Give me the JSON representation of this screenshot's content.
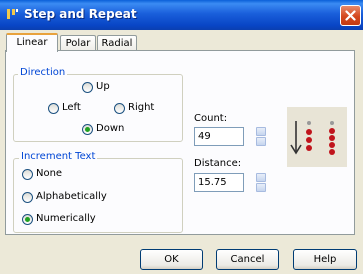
{
  "window": {
    "title": "Step and Repeat"
  },
  "tabs": [
    {
      "label": "Linear",
      "active": true
    },
    {
      "label": "Polar",
      "active": false
    },
    {
      "label": "Radial",
      "active": false
    }
  ],
  "direction": {
    "legend": "Direction",
    "options": {
      "up": "Up",
      "left": "Left",
      "right": "Right",
      "down": "Down"
    },
    "selected": "Down"
  },
  "increment_text": {
    "legend": "Increment Text",
    "options": {
      "none": "None",
      "alphabetically": "Alphabetically",
      "numerically": "Numerically"
    },
    "selected": "Numerically"
  },
  "count": {
    "label": "Count:",
    "value": "49"
  },
  "distance": {
    "label": "Distance:",
    "value": "15.75"
  },
  "buttons": {
    "ok": "OK",
    "cancel": "Cancel",
    "help": "Help"
  },
  "colors": {
    "accent": "#0a5fd8",
    "group_label": "#0046d5",
    "radio_dot": "#21a121",
    "preview_dot": "#c0141c"
  },
  "icons": {
    "close": "close-icon",
    "app": "step-repeat-app-icon",
    "preview": "down-arrow-dots-preview"
  }
}
